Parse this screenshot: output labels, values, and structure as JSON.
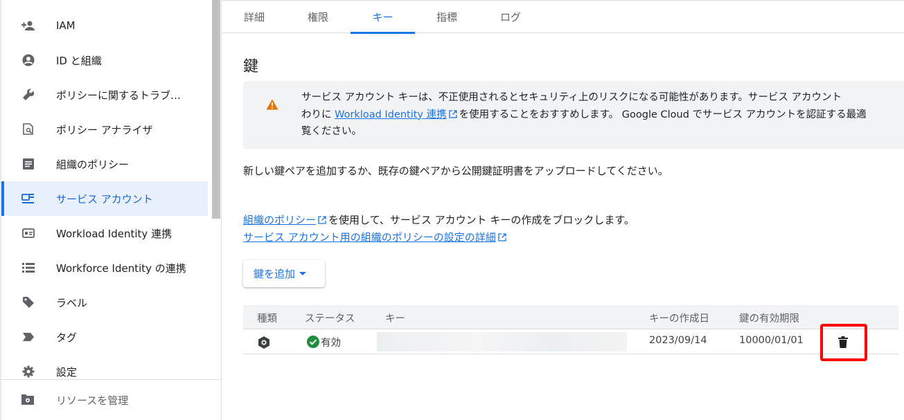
{
  "sidebar": {
    "items": [
      {
        "label": "IAM",
        "icon": "add-person-icon"
      },
      {
        "label": "ID と組織",
        "icon": "account-circle-icon"
      },
      {
        "label": "ポリシーに関するトラブ…",
        "icon": "wrench-icon"
      },
      {
        "label": "ポリシー アナライザ",
        "icon": "document-search-icon"
      },
      {
        "label": "組織のポリシー",
        "icon": "article-icon"
      },
      {
        "label": "サービス アカウント",
        "icon": "service-account-icon",
        "active": true
      },
      {
        "label": "Workload Identity 連携",
        "icon": "id-card-icon"
      },
      {
        "label": "Workforce Identity の連携",
        "icon": "list-icon"
      },
      {
        "label": "ラベル",
        "icon": "label-icon"
      },
      {
        "label": "タグ",
        "icon": "tag-icon"
      },
      {
        "label": "設定",
        "icon": "gear-icon"
      }
    ],
    "manage_label": "リソースを管理"
  },
  "tabs": [
    "詳細",
    "権限",
    "キー",
    "指標",
    "ログ"
  ],
  "active_tab": "キー",
  "main": {
    "heading": "鍵",
    "warning": {
      "text_1": "サービス アカウント キーは、不正使用されるとセキュリティ上のリスクになる可能性があります。サービス アカウント",
      "text_2a": "わりに ",
      "link": "Workload Identity 連携",
      "text_2b": "を使用することをおすすめします。 Google Cloud でサービス アカウントを認証する最適",
      "text_3": "覧ください。"
    },
    "description": "新しい鍵ペアを追加するか、既存の鍵ペアから公開鍵証明書をアップロードしてください。",
    "policy_link": "組織のポリシー",
    "policy_text": "を使用して、サービス アカウント キーの作成をブロックします。",
    "policy_detail_link": "サービス アカウント用の組織のポリシーの設定の詳細",
    "add_key_button": "鍵を追加"
  },
  "table": {
    "headers": [
      "種類",
      "ステータス",
      "キー",
      "キーの作成日",
      "鍵の有効期限"
    ],
    "rows": [
      {
        "status": "有効",
        "created": "2023/09/14",
        "expires": "10000/01/01"
      }
    ]
  },
  "colors": {
    "accent": "#1a73e8",
    "warning": "#e37400",
    "success": "#1e8e3e",
    "highlight": "#ff0000"
  }
}
